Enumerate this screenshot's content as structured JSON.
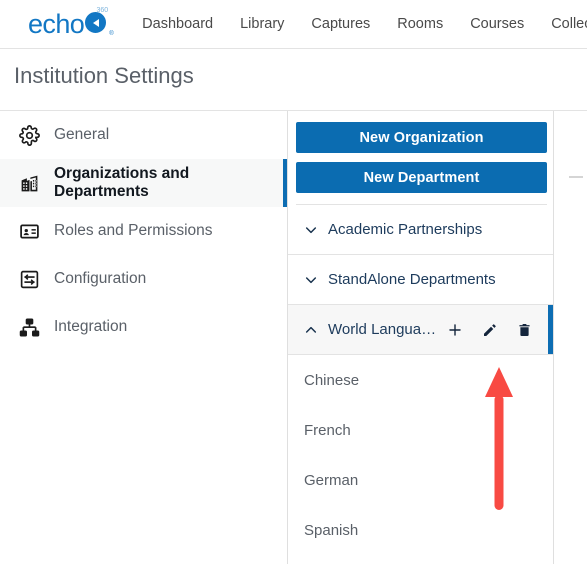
{
  "brand": {
    "word": "echo",
    "superscript": "360",
    "registered": "®",
    "color": "#1277c4"
  },
  "topnav": {
    "links": [
      {
        "label": "Dashboard",
        "name": "nav-dashboard"
      },
      {
        "label": "Library",
        "name": "nav-library"
      },
      {
        "label": "Captures",
        "name": "nav-captures"
      },
      {
        "label": "Rooms",
        "name": "nav-rooms"
      },
      {
        "label": "Courses",
        "name": "nav-courses"
      },
      {
        "label": "Collections",
        "name": "nav-collections"
      }
    ]
  },
  "page": {
    "title": "Institution Settings"
  },
  "settings_nav": {
    "items": [
      {
        "label": "General",
        "icon": "gear-icon",
        "active": false
      },
      {
        "label": "Organizations and Departments",
        "icon": "building-icon",
        "active": true
      },
      {
        "label": "Roles and Permissions",
        "icon": "id-badge-icon",
        "active": false
      },
      {
        "label": "Configuration",
        "icon": "sliders-icon",
        "active": false
      },
      {
        "label": "Integration",
        "icon": "sitemap-icon",
        "active": false
      }
    ],
    "active_accent": "#0d6db3"
  },
  "tree_panel": {
    "buttons": [
      {
        "label": "New Organization",
        "name": "new-organization-button"
      },
      {
        "label": "New Department",
        "name": "new-department-button"
      }
    ],
    "button_color": "#0b6cb1",
    "rows": [
      {
        "label": "Academic Partnerships",
        "chevron": "chevron-down-icon",
        "selected": false,
        "has_icons": false
      },
      {
        "label": "StandAlone Departments",
        "chevron": "chevron-down-icon",
        "selected": false,
        "has_icons": false
      },
      {
        "label": "World Langua…",
        "chevron": "chevron-up-icon",
        "selected": true,
        "has_icons": true
      }
    ],
    "row_icons": [
      {
        "name": "plus-icon",
        "title": "Add"
      },
      {
        "name": "pencil-icon",
        "title": "Edit"
      },
      {
        "name": "trash-icon",
        "title": "Delete"
      }
    ],
    "children": [
      {
        "label": "Chinese"
      },
      {
        "label": "French"
      },
      {
        "label": "German"
      },
      {
        "label": "Spanish"
      }
    ]
  },
  "annotation": {
    "arrow_color": "#f84a43",
    "points_to": "pencil-icon"
  }
}
